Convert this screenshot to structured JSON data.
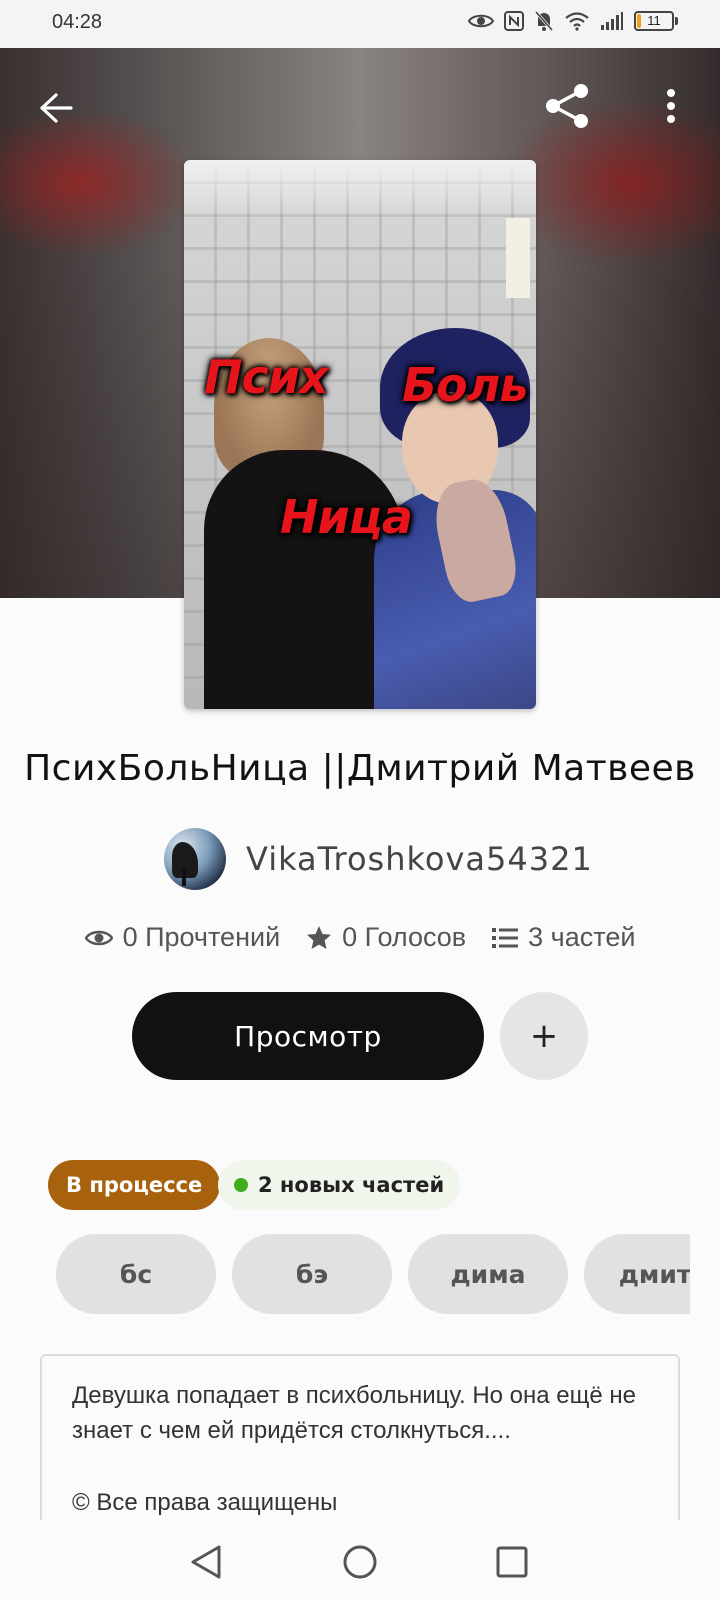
{
  "status_bar": {
    "time": "04:28",
    "battery": "11",
    "battery_level": 0.11,
    "icons": [
      "eye-icon",
      "nfc-icon",
      "bell-off-icon",
      "wifi-icon",
      "signal-icon",
      "battery-icon"
    ]
  },
  "header": {
    "back_icon": "arrow-left-icon",
    "share_icon": "share-icon",
    "more_icon": "more-vertical-icon"
  },
  "cover": {
    "words": [
      "Псих",
      "Боль",
      "Ница"
    ]
  },
  "story": {
    "title": "ПсихБольНица ||Дмитрий Матвеев",
    "author": "VikaTroshkova54321",
    "stats": {
      "reads": "0 Прочтений",
      "votes": "0 Голосов",
      "parts": "3 частей"
    },
    "read_button": "Просмотр",
    "add_button": "+",
    "status_label": "В процессе",
    "new_parts_label": "2 новых частей",
    "tags": [
      "бс",
      "бэ",
      "дима",
      "дмитр"
    ],
    "description": "Девушка попадает в психбольницу. Но она ещё не знает с чем ей придётся столкнуться....",
    "rights": "© Все права защищены"
  },
  "colors": {
    "status_pill": "#a8620e",
    "new_dot": "#3cae1c",
    "read_button": "#121012",
    "cover_text": "#e8141c"
  }
}
